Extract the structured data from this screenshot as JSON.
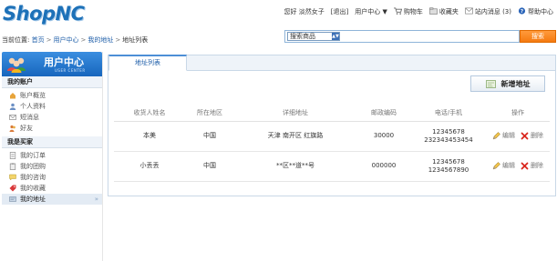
{
  "logo": {
    "text": "ShopNC"
  },
  "topnav": {
    "greeting": "您好 淡然女子",
    "logout": "[退出]",
    "user_center": "用户中心",
    "cart": "购物车",
    "favorites": "收藏夹",
    "messages": "站内消息",
    "messages_count": "(3)",
    "help": "帮助中心"
  },
  "breadcrumb": {
    "prefix": "当前位置:",
    "items": [
      "首页",
      "用户中心",
      "我的地址"
    ],
    "current": "地址列表"
  },
  "search": {
    "category": "搜索商品",
    "value": "",
    "button": "搜索"
  },
  "sidebar": {
    "title": "用户中心",
    "subtitle": "USER CENTER",
    "sections": [
      {
        "title": "我的账户",
        "items": [
          "账户概览",
          "个人资料",
          "短消息",
          "好友"
        ]
      },
      {
        "title": "我是买家",
        "items": [
          "我的订单",
          "我的团购",
          "我的咨询",
          "我的收藏",
          "我的地址"
        ]
      }
    ]
  },
  "panel": {
    "tab": "地址列表",
    "add_button": "新增地址",
    "columns": [
      "收货人姓名",
      "所在地区",
      "详细地址",
      "邮政编码",
      "电话/手机",
      "操作"
    ],
    "rows": [
      {
        "name": "本美",
        "region": "中国",
        "address": "天津 南开区 红旗路",
        "zip": "30000",
        "phone1": "12345678",
        "phone2": "232343453454",
        "edit": "编辑",
        "delete": "删除"
      },
      {
        "name": "小丢丢",
        "region": "中国",
        "address": "**区**道**号",
        "zip": "000000",
        "phone1": "12345678",
        "phone2": "1234567890",
        "edit": "编辑",
        "delete": "删除"
      }
    ]
  },
  "colors": {
    "brand_blue": "#1d71b8",
    "accent_orange": "#f57a10",
    "link": "#1d5da8"
  }
}
